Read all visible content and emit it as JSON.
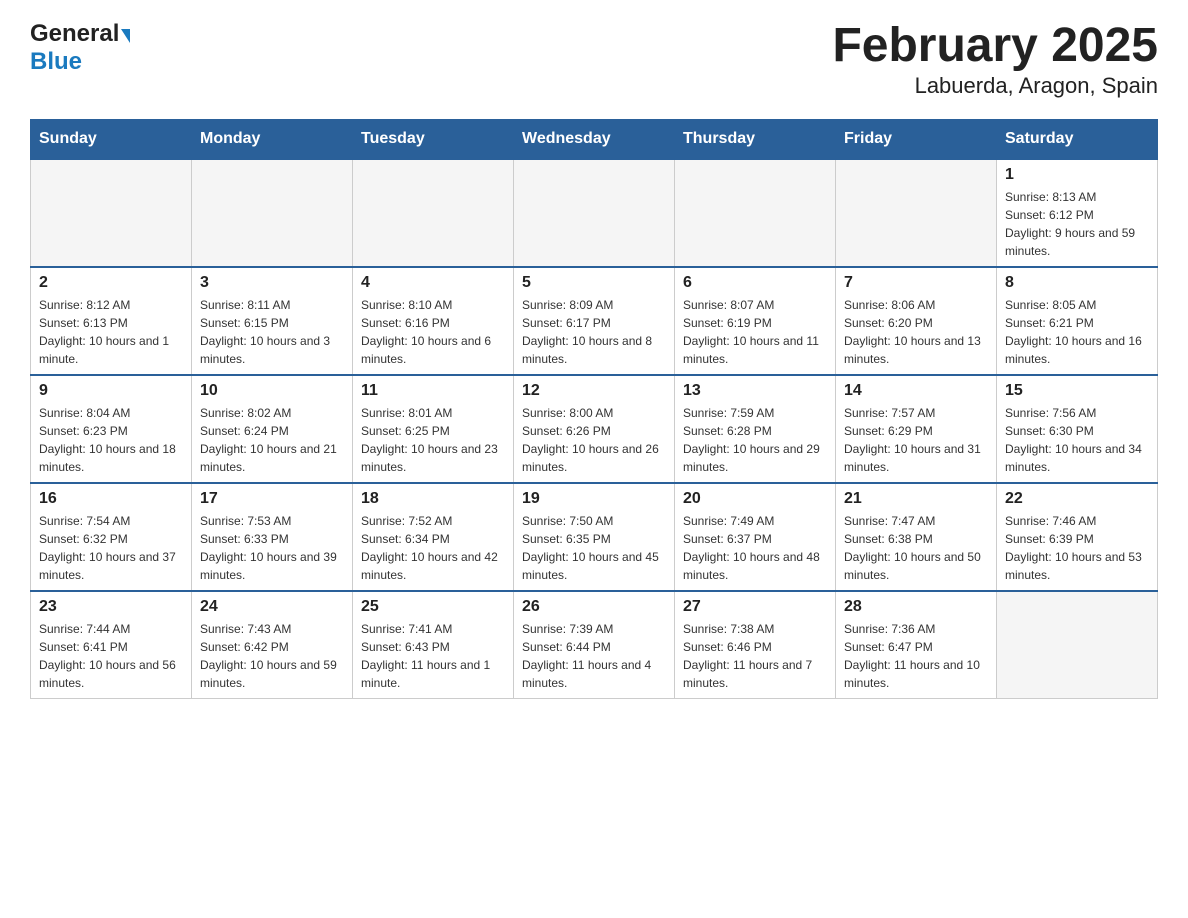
{
  "header": {
    "logo_general": "General",
    "logo_blue": "Blue",
    "title": "February 2025",
    "subtitle": "Labuerda, Aragon, Spain"
  },
  "calendar": {
    "days_of_week": [
      "Sunday",
      "Monday",
      "Tuesday",
      "Wednesday",
      "Thursday",
      "Friday",
      "Saturday"
    ],
    "weeks": [
      [
        {
          "day": "",
          "info": ""
        },
        {
          "day": "",
          "info": ""
        },
        {
          "day": "",
          "info": ""
        },
        {
          "day": "",
          "info": ""
        },
        {
          "day": "",
          "info": ""
        },
        {
          "day": "",
          "info": ""
        },
        {
          "day": "1",
          "info": "Sunrise: 8:13 AM\nSunset: 6:12 PM\nDaylight: 9 hours and 59 minutes."
        }
      ],
      [
        {
          "day": "2",
          "info": "Sunrise: 8:12 AM\nSunset: 6:13 PM\nDaylight: 10 hours and 1 minute."
        },
        {
          "day": "3",
          "info": "Sunrise: 8:11 AM\nSunset: 6:15 PM\nDaylight: 10 hours and 3 minutes."
        },
        {
          "day": "4",
          "info": "Sunrise: 8:10 AM\nSunset: 6:16 PM\nDaylight: 10 hours and 6 minutes."
        },
        {
          "day": "5",
          "info": "Sunrise: 8:09 AM\nSunset: 6:17 PM\nDaylight: 10 hours and 8 minutes."
        },
        {
          "day": "6",
          "info": "Sunrise: 8:07 AM\nSunset: 6:19 PM\nDaylight: 10 hours and 11 minutes."
        },
        {
          "day": "7",
          "info": "Sunrise: 8:06 AM\nSunset: 6:20 PM\nDaylight: 10 hours and 13 minutes."
        },
        {
          "day": "8",
          "info": "Sunrise: 8:05 AM\nSunset: 6:21 PM\nDaylight: 10 hours and 16 minutes."
        }
      ],
      [
        {
          "day": "9",
          "info": "Sunrise: 8:04 AM\nSunset: 6:23 PM\nDaylight: 10 hours and 18 minutes."
        },
        {
          "day": "10",
          "info": "Sunrise: 8:02 AM\nSunset: 6:24 PM\nDaylight: 10 hours and 21 minutes."
        },
        {
          "day": "11",
          "info": "Sunrise: 8:01 AM\nSunset: 6:25 PM\nDaylight: 10 hours and 23 minutes."
        },
        {
          "day": "12",
          "info": "Sunrise: 8:00 AM\nSunset: 6:26 PM\nDaylight: 10 hours and 26 minutes."
        },
        {
          "day": "13",
          "info": "Sunrise: 7:59 AM\nSunset: 6:28 PM\nDaylight: 10 hours and 29 minutes."
        },
        {
          "day": "14",
          "info": "Sunrise: 7:57 AM\nSunset: 6:29 PM\nDaylight: 10 hours and 31 minutes."
        },
        {
          "day": "15",
          "info": "Sunrise: 7:56 AM\nSunset: 6:30 PM\nDaylight: 10 hours and 34 minutes."
        }
      ],
      [
        {
          "day": "16",
          "info": "Sunrise: 7:54 AM\nSunset: 6:32 PM\nDaylight: 10 hours and 37 minutes."
        },
        {
          "day": "17",
          "info": "Sunrise: 7:53 AM\nSunset: 6:33 PM\nDaylight: 10 hours and 39 minutes."
        },
        {
          "day": "18",
          "info": "Sunrise: 7:52 AM\nSunset: 6:34 PM\nDaylight: 10 hours and 42 minutes."
        },
        {
          "day": "19",
          "info": "Sunrise: 7:50 AM\nSunset: 6:35 PM\nDaylight: 10 hours and 45 minutes."
        },
        {
          "day": "20",
          "info": "Sunrise: 7:49 AM\nSunset: 6:37 PM\nDaylight: 10 hours and 48 minutes."
        },
        {
          "day": "21",
          "info": "Sunrise: 7:47 AM\nSunset: 6:38 PM\nDaylight: 10 hours and 50 minutes."
        },
        {
          "day": "22",
          "info": "Sunrise: 7:46 AM\nSunset: 6:39 PM\nDaylight: 10 hours and 53 minutes."
        }
      ],
      [
        {
          "day": "23",
          "info": "Sunrise: 7:44 AM\nSunset: 6:41 PM\nDaylight: 10 hours and 56 minutes."
        },
        {
          "day": "24",
          "info": "Sunrise: 7:43 AM\nSunset: 6:42 PM\nDaylight: 10 hours and 59 minutes."
        },
        {
          "day": "25",
          "info": "Sunrise: 7:41 AM\nSunset: 6:43 PM\nDaylight: 11 hours and 1 minute."
        },
        {
          "day": "26",
          "info": "Sunrise: 7:39 AM\nSunset: 6:44 PM\nDaylight: 11 hours and 4 minutes."
        },
        {
          "day": "27",
          "info": "Sunrise: 7:38 AM\nSunset: 6:46 PM\nDaylight: 11 hours and 7 minutes."
        },
        {
          "day": "28",
          "info": "Sunrise: 7:36 AM\nSunset: 6:47 PM\nDaylight: 11 hours and 10 minutes."
        },
        {
          "day": "",
          "info": ""
        }
      ]
    ]
  }
}
